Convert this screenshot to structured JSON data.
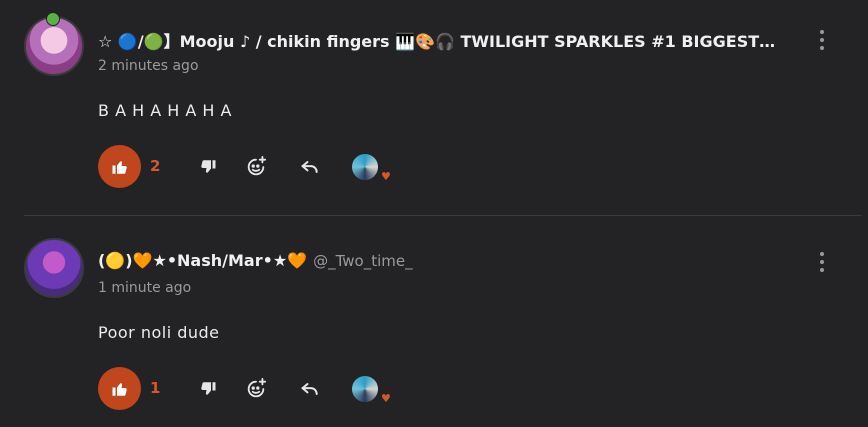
{
  "comments": [
    {
      "username": "☆ 🔵/🟢】Mooju ♪ / chikin fingers 🎹🎨🎧 TWILIGHT SPARKLES #1 BIGGEST…",
      "handle": "",
      "timestamp": "2 minutes ago",
      "text": "B A H A H A H A",
      "like_count": "2",
      "liked": true,
      "reaction_icon": "heart-icon"
    },
    {
      "username": "(🟡)🧡★•Nash/Mar•★🧡",
      "handle": "@_Two_time_",
      "timestamp": "1 minute ago",
      "text": "Poor noli dude",
      "like_count": "1",
      "liked": true,
      "reaction_icon": "heart-icon"
    }
  ],
  "colors": {
    "background": "#232325",
    "accent": "#c0461e",
    "accent_text": "#d5572b",
    "muted_text": "#9a9a9a"
  }
}
